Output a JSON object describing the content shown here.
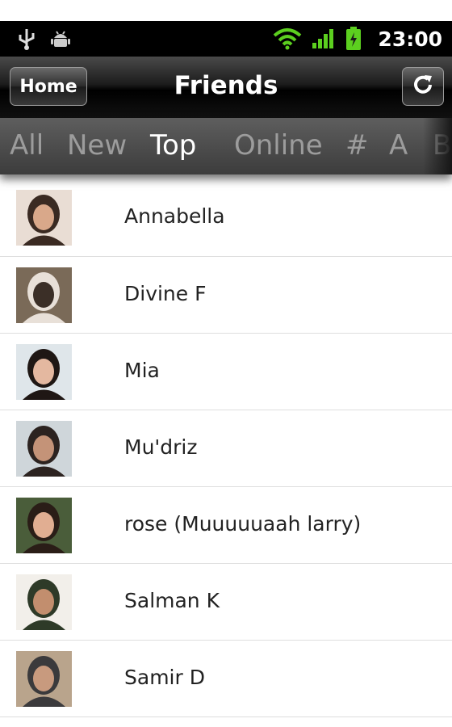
{
  "status_bar": {
    "time": "23:00",
    "icons": [
      "usb-icon",
      "android-debug-icon",
      "wifi-icon",
      "signal-icon",
      "battery-charging-icon"
    ]
  },
  "title_bar": {
    "home_label": "Home",
    "title": "Friends",
    "refresh_icon": "refresh-icon"
  },
  "tabs": [
    {
      "label": "All",
      "active": false
    },
    {
      "label": "New",
      "active": false
    },
    {
      "label": "Top",
      "active": true
    },
    {
      "label": "Online",
      "active": false
    },
    {
      "label": "#",
      "active": false
    },
    {
      "label": "A",
      "active": false
    },
    {
      "label": "B",
      "active": false
    }
  ],
  "friends": [
    {
      "name": "Annabella",
      "avatar_colors": [
        "#e9ddd4",
        "#3a2a22",
        "#d9a88a"
      ]
    },
    {
      "name": "Divine F",
      "avatar_colors": [
        "#7a6a58",
        "#e8e0d8",
        "#3b2f27"
      ]
    },
    {
      "name": "Mia",
      "avatar_colors": [
        "#dfe6ea",
        "#1f1714",
        "#e4b8a0"
      ]
    },
    {
      "name": "Mu'driz",
      "avatar_colors": [
        "#cfd6da",
        "#2c2320",
        "#c49378"
      ]
    },
    {
      "name": "rose (Muuuuuaah larry)",
      "avatar_colors": [
        "#4a5d3a",
        "#2a1d17",
        "#e1ae92"
      ]
    },
    {
      "name": "Salman K",
      "avatar_colors": [
        "#f2efea",
        "#2e3a28",
        "#c28e6e"
      ]
    },
    {
      "name": "Samir D",
      "avatar_colors": [
        "#b9a48c",
        "#3b3a3c",
        "#c89a7e"
      ]
    }
  ]
}
